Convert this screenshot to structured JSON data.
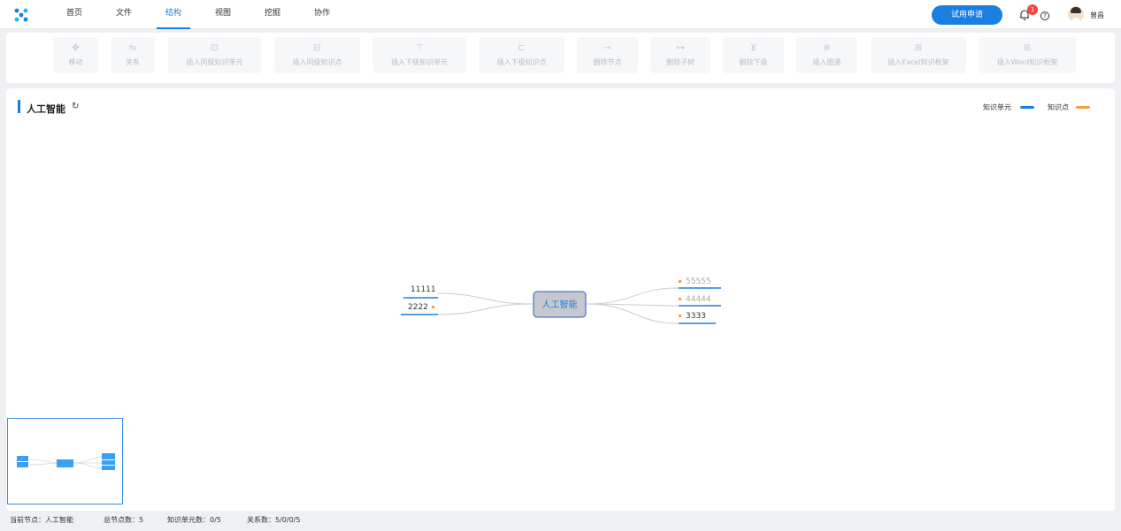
{
  "nav": {
    "tabs": [
      "首页",
      "文件",
      "结构",
      "视图",
      "挖掘",
      "协作"
    ],
    "active_tab": "结构",
    "trial_button": "试用申请",
    "notification_count": "1",
    "help_glyph": "?",
    "username": "曾昌"
  },
  "toolbar": {
    "items": [
      {
        "label": "移动",
        "icon": "move-icon",
        "glyph": "✥"
      },
      {
        "label": "关系",
        "icon": "relation-icon",
        "glyph": "⇋"
      },
      {
        "label": "插入同级知识单元",
        "icon": "insert-sibling-unit-icon",
        "glyph": "⊡"
      },
      {
        "label": "插入同级知识点",
        "icon": "insert-sibling-point-icon",
        "glyph": "⊟"
      },
      {
        "label": "插入下级知识单元",
        "icon": "insert-child-unit-icon",
        "glyph": "⊤"
      },
      {
        "label": "插入下级知识点",
        "icon": "insert-child-point-icon",
        "glyph": "⊏"
      },
      {
        "label": "删除节点",
        "icon": "delete-node-icon",
        "glyph": "⊸"
      },
      {
        "label": "删除子树",
        "icon": "delete-subtree-icon",
        "glyph": "⊶"
      },
      {
        "label": "删除下级",
        "icon": "delete-children-icon",
        "glyph": "⊻"
      },
      {
        "label": "插入图谱",
        "icon": "insert-graph-icon",
        "glyph": "⊕"
      },
      {
        "label": "插入Excel知识框架",
        "icon": "excel-icon",
        "glyph": "⊞"
      },
      {
        "label": "插入Word知识框架",
        "icon": "word-icon",
        "glyph": "⊞"
      }
    ]
  },
  "panel": {
    "title": "人工智能",
    "refresh_glyph": "↻",
    "legend": [
      {
        "label": "知识单元",
        "color": "#1a7fe0"
      },
      {
        "label": "知识点",
        "color": "#f0a040"
      }
    ]
  },
  "mindmap": {
    "root": "人工智能",
    "left_nodes": [
      "11111",
      "2222"
    ],
    "right_nodes": [
      "55555",
      "44444",
      "3333"
    ]
  },
  "status": {
    "current_node_label": "当前节点：",
    "current_node": "人工智能",
    "total_nodes_label": "总节点数：",
    "total_nodes": "5",
    "units_label": "知识单元数：",
    "units": "0/5",
    "relations_label": "关系数：",
    "relations": "5/0/0/5"
  },
  "colors": {
    "accent": "#1a7fe0",
    "knowledge_point": "#f0a040",
    "badge": "#f0463e"
  }
}
